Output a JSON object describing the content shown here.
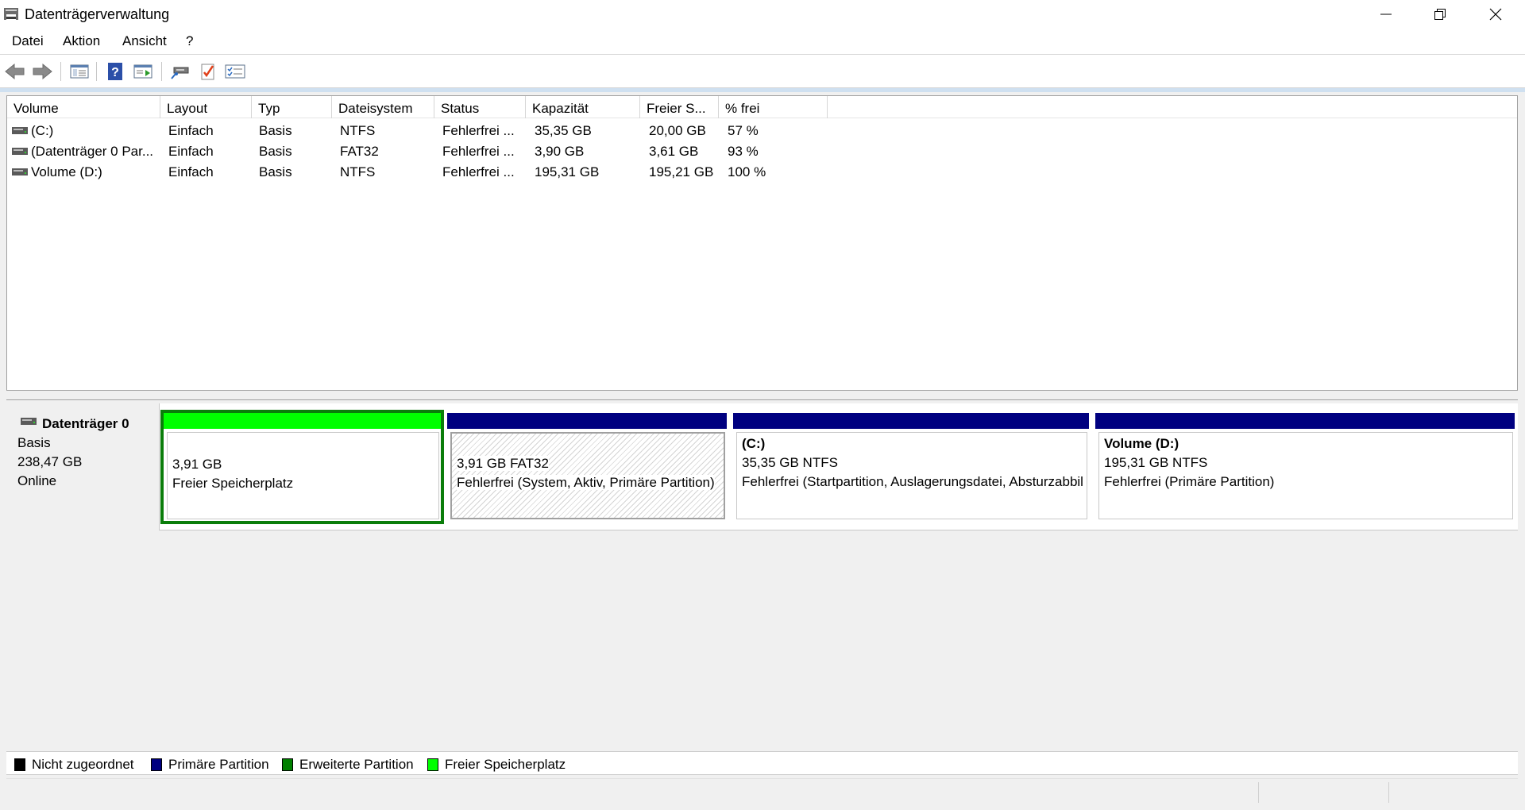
{
  "window": {
    "title": "Datenträgerverwaltung"
  },
  "menu": [
    "Datei",
    "Aktion",
    "Ansicht",
    "?"
  ],
  "toolbar": {
    "icons": [
      "back-arrow-icon",
      "forward-arrow-icon",
      "console-tree-icon",
      "help-icon",
      "action-pane-icon",
      "connect-drive-icon",
      "properties-check-icon",
      "list-view-icon"
    ]
  },
  "volume_list": {
    "columns": [
      "Volume",
      "Layout",
      "Typ",
      "Dateisystem",
      "Status",
      "Kapazität",
      "Freier S...",
      "% frei"
    ],
    "rows": [
      {
        "volume": " (C:)",
        "layout": "Einfach",
        "typ": "Basis",
        "fs": "NTFS",
        "status": "Fehlerfrei ...",
        "capacity": "35,35 GB",
        "free": "20,00 GB",
        "pct": "57 %"
      },
      {
        "volume": "(Datenträger 0 Par...",
        "layout": "Einfach",
        "typ": "Basis",
        "fs": "FAT32",
        "status": "Fehlerfrei ...",
        "capacity": "3,90 GB",
        "free": "3,61 GB",
        "pct": "93 %"
      },
      {
        "volume": "Volume (D:)",
        "layout": "Einfach",
        "typ": "Basis",
        "fs": "NTFS",
        "status": "Fehlerfrei ...",
        "capacity": "195,31 GB",
        "free": "195,21 GB",
        "pct": "100 %"
      }
    ]
  },
  "disk": {
    "name": "Datenträger 0",
    "type": "Basis",
    "size": "238,47 GB",
    "state": "Online",
    "partitions": [
      {
        "title": "",
        "line1": "3,91 GB",
        "line2": "Freier Speicherplatz",
        "bar_color": "#00ff00"
      },
      {
        "title": "",
        "line1": "3,91 GB FAT32",
        "line2": "Fehlerfrei (System, Aktiv, Primäre Partition)",
        "bar_color": "#000080"
      },
      {
        "title": " (C:)",
        "line1": "35,35 GB NTFS",
        "line2": "Fehlerfrei (Startpartition, Auslagerungsdatei, Absturzabbild, Primäre Partition)",
        "bar_color": "#000080"
      },
      {
        "title": "Volume  (D:)",
        "line1": "195,31 GB NTFS",
        "line2": "Fehlerfrei (Primäre Partition)",
        "bar_color": "#000080"
      }
    ]
  },
  "legend": [
    {
      "label": "Nicht zugeordnet",
      "color": "#000000"
    },
    {
      "label": "Primäre Partition",
      "color": "#000080"
    },
    {
      "label": "Erweiterte Partition",
      "color": "#008000"
    },
    {
      "label": "Freier Speicherplatz",
      "color": "#00ff00"
    }
  ]
}
